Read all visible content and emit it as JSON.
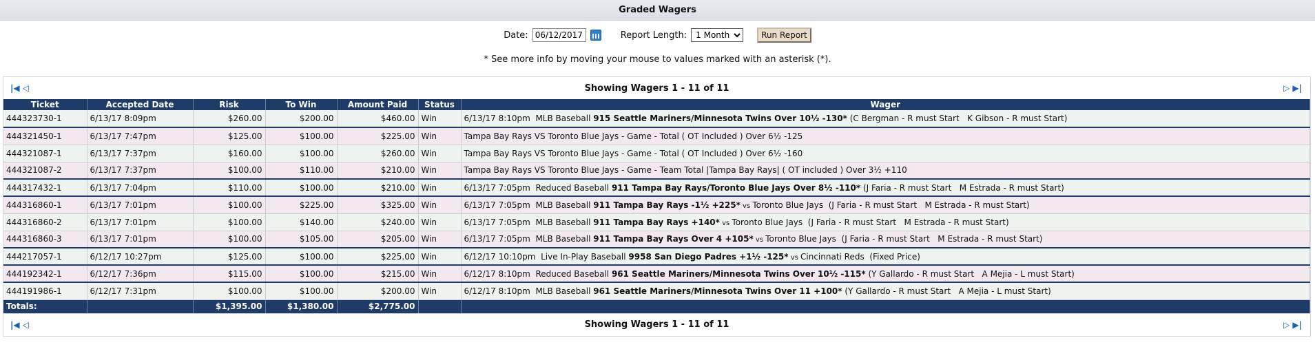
{
  "header": {
    "title": "Graded Wagers"
  },
  "form": {
    "date_label": "Date:",
    "date_value": "06/12/2017",
    "report_length_label": "Report Length:",
    "report_length_value": "1 Month",
    "run_button": "Run Report"
  },
  "note": "* See more info by moving your mouse to values marked with an asterisk (*).",
  "pager": {
    "text": "Showing Wagers 1 - 11 of 11"
  },
  "columns": [
    "Ticket",
    "Accepted Date",
    "Risk",
    "To Win",
    "Amount Paid",
    "Status",
    "Wager"
  ],
  "rows": [
    {
      "ticket": "444323730-1",
      "date": "6/13/17 8:09pm",
      "risk": "$260.00",
      "towin": "$200.00",
      "paid": "$460.00",
      "status": "Win",
      "w_pre": "6/13/17 8:10pm  MLB Baseball ",
      "w_bold": "915 Seattle Mariners/Minnesota Twins Over 10½ -130*",
      "w_vs": "",
      "w_post": " (C Bergman - R must Start   K Gibson - R must Start)"
    },
    {
      "ticket": "444321450-1",
      "date": "6/13/17 7:47pm",
      "risk": "$125.00",
      "towin": "$100.00",
      "paid": "$225.00",
      "status": "Win",
      "w_pre": "Tampa Bay Rays VS Toronto Blue Jays - Game - Total ( OT Included ) Over 6½ -125",
      "w_bold": "",
      "w_vs": "",
      "w_post": ""
    },
    {
      "ticket": "444321087-1",
      "date": "6/13/17 7:37pm",
      "risk": "$160.00",
      "towin": "$100.00",
      "paid": "$260.00",
      "status": "Win",
      "w_pre": "Tampa Bay Rays VS Toronto Blue Jays - Game - Total ( OT Included ) Over 6½ -160",
      "w_bold": "",
      "w_vs": "",
      "w_post": ""
    },
    {
      "ticket": "444321087-2",
      "date": "6/13/17 7:37pm",
      "risk": "$100.00",
      "towin": "$110.00",
      "paid": "$210.00",
      "status": "Win",
      "w_pre": "Tampa Bay Rays VS Toronto Blue Jays - Game - Team Total |Tampa Bay Rays| ( OT included ) Over 3½ +110",
      "w_bold": "",
      "w_vs": "",
      "w_post": ""
    },
    {
      "ticket": "444317432-1",
      "date": "6/13/17 7:04pm",
      "risk": "$110.00",
      "towin": "$100.00",
      "paid": "$210.00",
      "status": "Win",
      "w_pre": "6/13/17 7:05pm  Reduced Baseball ",
      "w_bold": "911 Tampa Bay Rays/Toronto Blue Jays Over 8½ -110*",
      "w_vs": "",
      "w_post": " (J Faria - R must Start   M Estrada - R must Start)"
    },
    {
      "ticket": "444316860-1",
      "date": "6/13/17 7:01pm",
      "risk": "$100.00",
      "towin": "$225.00",
      "paid": "$325.00",
      "status": "Win",
      "w_pre": "6/13/17 7:05pm  MLB Baseball ",
      "w_bold": "911 Tampa Bay Rays -1½ +225*",
      "w_vs": " vs ",
      "w_post": "Toronto Blue Jays  (J Faria - R must Start   M Estrada - R must Start)"
    },
    {
      "ticket": "444316860-2",
      "date": "6/13/17 7:01pm",
      "risk": "$100.00",
      "towin": "$140.00",
      "paid": "$240.00",
      "status": "Win",
      "w_pre": "6/13/17 7:05pm  MLB Baseball ",
      "w_bold": "911 Tampa Bay Rays +140*",
      "w_vs": " vs ",
      "w_post": "Toronto Blue Jays  (J Faria - R must Start   M Estrada - R must Start)"
    },
    {
      "ticket": "444316860-3",
      "date": "6/13/17 7:01pm",
      "risk": "$100.00",
      "towin": "$105.00",
      "paid": "$205.00",
      "status": "Win",
      "w_pre": "6/13/17 7:05pm  MLB Baseball ",
      "w_bold": "911 Tampa Bay Rays Over 4 +105*",
      "w_vs": " vs ",
      "w_post": "Toronto Blue Jays  (J Faria - R must Start   M Estrada - R must Start)"
    },
    {
      "ticket": "444217057-1",
      "date": "6/12/17 10:27pm",
      "risk": "$125.00",
      "towin": "$100.00",
      "paid": "$225.00",
      "status": "Win",
      "w_pre": "6/12/17 10:10pm  Live In-Play Baseball ",
      "w_bold": "9958 San Diego Padres +1½ -125*",
      "w_vs": " vs ",
      "w_post": "Cincinnati Reds  (Fixed Price)"
    },
    {
      "ticket": "444192342-1",
      "date": "6/12/17 7:36pm",
      "risk": "$115.00",
      "towin": "$100.00",
      "paid": "$215.00",
      "status": "Win",
      "w_pre": "6/12/17 8:10pm  Reduced Baseball ",
      "w_bold": "961 Seattle Mariners/Minnesota Twins Over 10½ -115*",
      "w_vs": "",
      "w_post": " (Y Gallardo - R must Start   A Mejia - L must Start)"
    },
    {
      "ticket": "444191986-1",
      "date": "6/12/17 7:31pm",
      "risk": "$100.00",
      "towin": "$100.00",
      "paid": "$200.00",
      "status": "Win",
      "w_pre": "6/12/17 8:10pm  MLB Baseball ",
      "w_bold": "961 Seattle Mariners/Minnesota Twins Over 11 +100*",
      "w_vs": "",
      "w_post": " (Y Gallardo - R must Start   A Mejia - L must Start)"
    }
  ],
  "totals": {
    "label": "Totals:",
    "risk": "$1,395.00",
    "towin": "$1,380.00",
    "paid": "$2,775.00"
  },
  "colors": {
    "header_bg": "#1f3b68",
    "row_odd": "#eef3ef",
    "row_even": "#f3e8ee",
    "nav_icon": "#1f5fb0"
  },
  "icons": {
    "first": "first-page-icon",
    "prev": "prev-page-icon",
    "next": "next-page-icon",
    "last": "last-page-icon",
    "calendar": "calendar-icon"
  }
}
